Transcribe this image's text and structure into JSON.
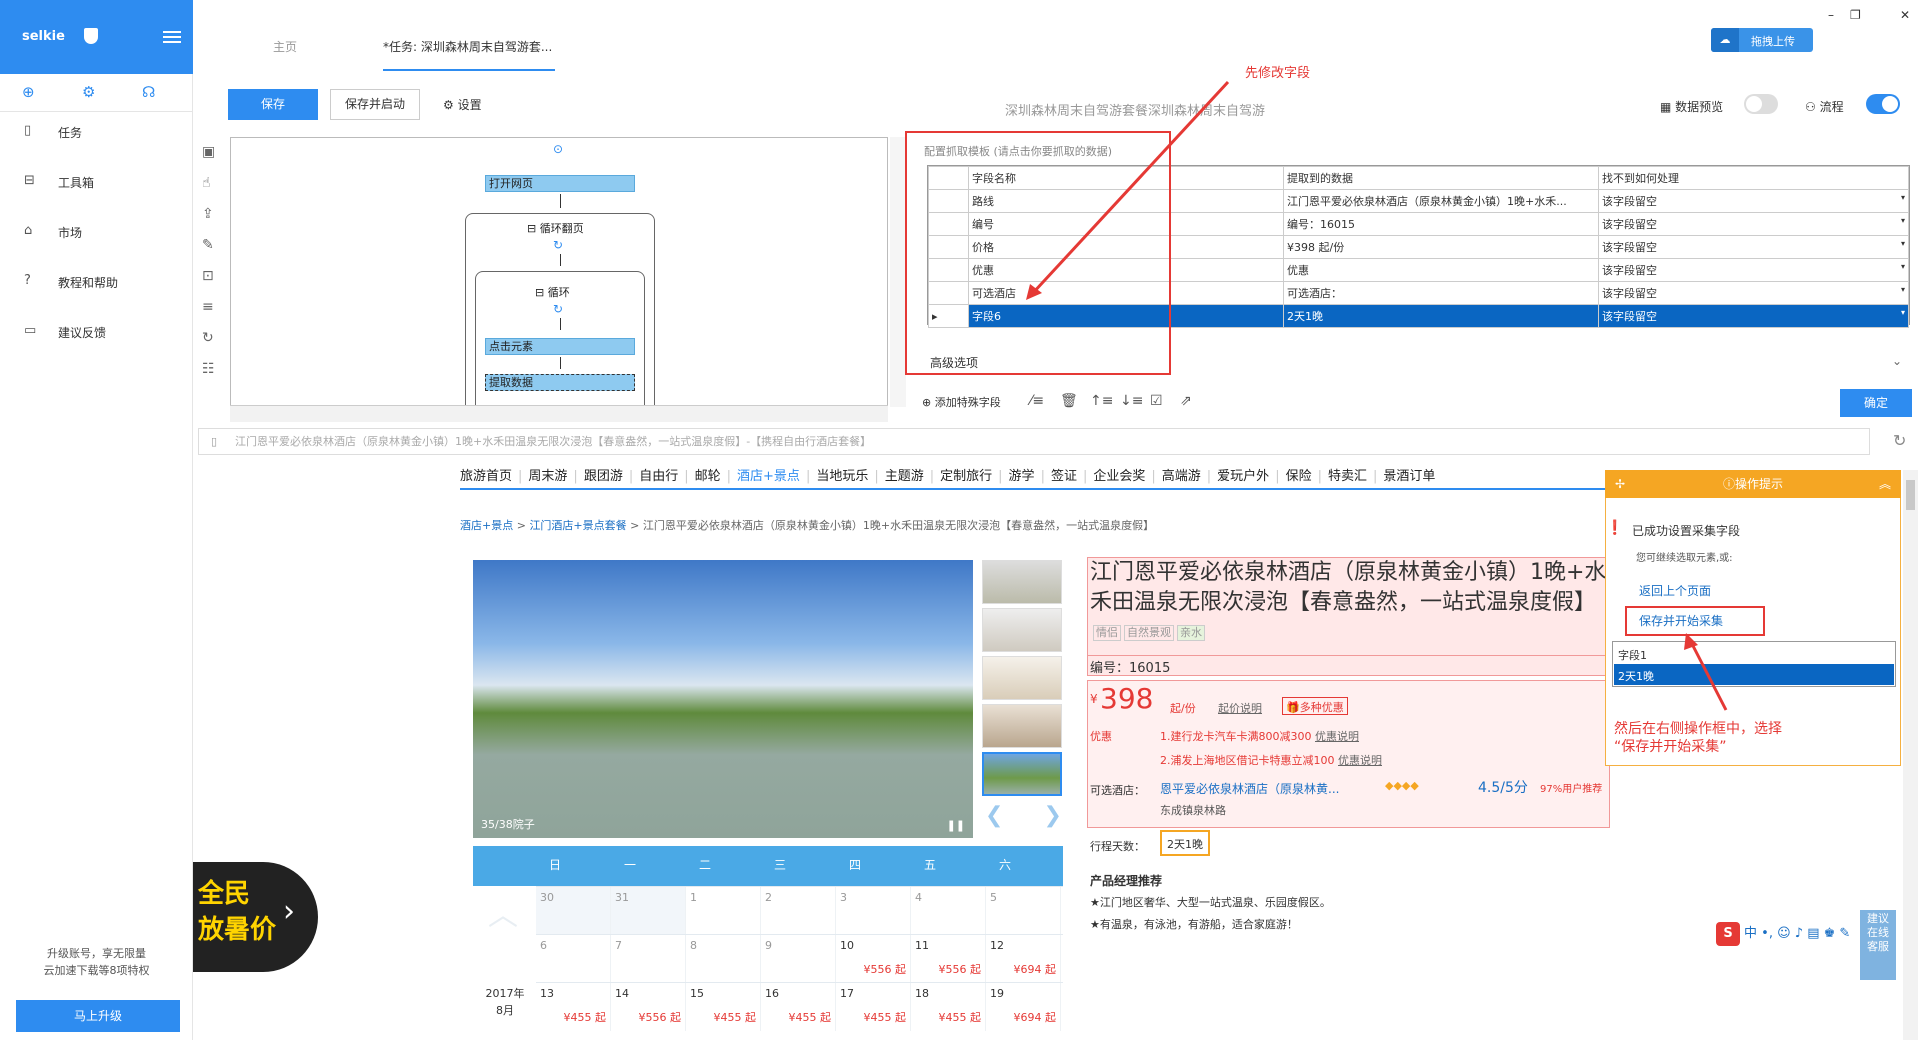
{
  "app": {
    "logo": "selkie",
    "upgrade_text": "升级账号，享无限量\n云加速下载等8项特权",
    "upgrade_button": "马上升级"
  },
  "sidebar": {
    "items": [
      {
        "label": "任务",
        "icon": "file-icon"
      },
      {
        "label": "工具箱",
        "icon": "toolbox-icon"
      },
      {
        "label": "市场",
        "icon": "lock-icon"
      },
      {
        "label": "教程和帮助",
        "icon": "help-icon"
      },
      {
        "label": "建议反馈",
        "icon": "feedback-icon"
      }
    ]
  },
  "tabs": {
    "home": "主页",
    "task": "*任务: 深圳森林周末自驾游套..."
  },
  "toolbar": {
    "save": "保存",
    "save_start": "保存并启动",
    "settings": "设置",
    "title": "深圳森林周末自驾游套餐深圳森林周末自驾游",
    "data_preview": "数据预览",
    "flow": "流程",
    "upload": "拖拽上传",
    "data_preview_on": false,
    "flow_on": true
  },
  "annotation": {
    "top": "先修改字段",
    "right": "然后在右侧操作框中，选择\n“保存并开始采集”"
  },
  "flow": {
    "open_page": "打开网页",
    "loop_page": "循环翻页",
    "loop": "循环",
    "click": "点击元素",
    "extract": "提取数据"
  },
  "config": {
    "title": "配置抓取模板 (请点击你要抓取的数据)",
    "headers": [
      "字段名称",
      "提取到的数据",
      "找不到如何处理"
    ],
    "rows": [
      {
        "name": "路线",
        "data": "江门恩平爱必依泉林酒店（原泉林黄金小镇）1晚+水禾...",
        "handle": "该字段留空"
      },
      {
        "name": "编号",
        "data": "编号：16015",
        "handle": "该字段留空"
      },
      {
        "name": "价格",
        "data": "¥398                起/份",
        "handle": "该字段留空"
      },
      {
        "name": "优惠",
        "data": "优惠",
        "handle": "该字段留空"
      },
      {
        "name": "可选酒店",
        "data": "可选酒店：",
        "handle": "该字段留空"
      },
      {
        "name": "字段6",
        "data": "2天1晚",
        "handle": "该字段留空"
      }
    ],
    "advanced": "高级选项",
    "add_special": "添加特殊字段",
    "confirm": "确定"
  },
  "url": "江门恩平爱必依泉林酒店（原泉林黄金小镇）1晚+水禾田温泉无限次浸泡【春意盎然，一站式温泉度假】-【携程自由行酒店套餐】",
  "web": {
    "nav": [
      "旅游首页",
      "周末游",
      "跟团游",
      "自由行",
      "邮轮",
      "酒店+景点",
      "当地玩乐",
      "主题游",
      "定制旅行",
      "游学",
      "签证",
      "企业会奖",
      "高端游",
      "爱玩户外",
      "保险",
      "特卖汇",
      "景酒订单"
    ],
    "breadcrumb": [
      "酒店+景点",
      "江门酒店+景点套餐",
      "江门恩平爱必依泉林酒店（原泉林黄金小镇）1晚+水禾田温泉无限次浸泡【春意盎然，一站式温泉度假】"
    ],
    "image_caption": "35/38院子",
    "title": "江门恩平爱必依泉林酒店（原泉林黄金小镇）1晚+水禾田温泉无限次浸泡【春意盎然，一站式温泉度假】",
    "tags": [
      "情侣",
      "自然景观",
      "亲水"
    ],
    "code": "编号：16015",
    "price": "398",
    "price_unit": "起/份",
    "price_desc": "起价说明",
    "multi_discount": "多种优惠",
    "discount_label": "优惠",
    "discounts": [
      {
        "text": "1.建行龙卡汽车卡满800减300",
        "link": "优惠说明"
      },
      {
        "text": "2.浦发上海地区借记卡特惠立减100",
        "link": "优惠说明"
      }
    ],
    "hotel_label": "可选酒店：",
    "hotel_name": "恩平爱必依泉林酒店（原泉林黄...",
    "hotel_score": "4.5/5分",
    "hotel_rec": "97%用户推荐",
    "hotel_addr": "东成镇泉林路",
    "days_label": "行程天数：",
    "days_value": "2天1晚",
    "manager_title": "产品经理推荐",
    "manager_lines": [
      "★江门地区奢华、大型一站式温泉、乐园度假区。",
      "★有温泉，有泳池，有游船，适合家庭游！"
    ],
    "promo": "全民\n放暑价",
    "calendar": {
      "weekdays": [
        "日",
        "一",
        "二",
        "三",
        "四",
        "五",
        "六"
      ],
      "month": "2017年\n8月",
      "rows": [
        [
          {
            "d": "30",
            "p": ""
          },
          {
            "d": "31",
            "p": ""
          },
          {
            "d": "1",
            "p": ""
          },
          {
            "d": "2",
            "p": ""
          },
          {
            "d": "3",
            "p": ""
          },
          {
            "d": "4",
            "p": ""
          },
          {
            "d": "5",
            "p": ""
          }
        ],
        [
          {
            "d": "6",
            "p": ""
          },
          {
            "d": "7",
            "p": ""
          },
          {
            "d": "8",
            "p": ""
          },
          {
            "d": "9",
            "p": ""
          },
          {
            "d": "10",
            "p": "¥556 起"
          },
          {
            "d": "11",
            "p": "¥556 起"
          },
          {
            "d": "12",
            "p": "¥694 起"
          }
        ],
        [
          {
            "d": "13",
            "p": "¥455 起"
          },
          {
            "d": "14",
            "p": "¥556 起"
          },
          {
            "d": "15",
            "p": "¥455 起"
          },
          {
            "d": "16",
            "p": "¥455 起"
          },
          {
            "d": "17",
            "p": "¥455 起"
          },
          {
            "d": "18",
            "p": "¥455 起"
          },
          {
            "d": "19",
            "p": "¥694 起"
          }
        ]
      ]
    }
  },
  "tip": {
    "header": "操作提示",
    "success": "已成功设置采集字段",
    "sub": "您可继续选取元素,或:",
    "back": "返回上个页面",
    "save_start": "保存并开始采集",
    "list": [
      "字段1",
      "2天1晚"
    ]
  },
  "help": {
    "label": "建议\n在线\n客服"
  },
  "ime": {
    "label": "中"
  }
}
